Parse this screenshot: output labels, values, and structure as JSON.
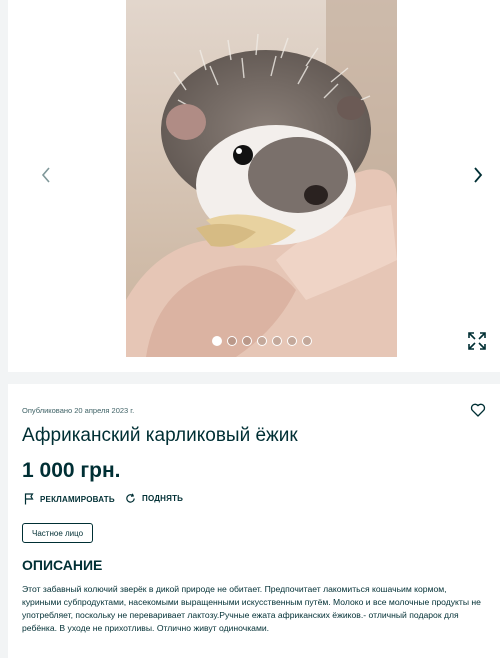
{
  "gallery": {
    "image_alt": "African pygmy hedgehog in hand",
    "image_count": 7,
    "active_index": 0,
    "icons": {
      "prev": "chevron-left-icon",
      "next": "chevron-right-icon",
      "expand": "expand-icon"
    }
  },
  "listing": {
    "published": "Опубликовано 20 апреля 2023 г.",
    "title": "Африканский карликовый ёжик",
    "price": "1 000 грн.",
    "actions": {
      "promote_label": "РЕКЛАМИРОВАТЬ",
      "raise_label": "ПОДНЯТЬ"
    },
    "seller_type": "Частное лицо",
    "description_heading": "ОПИСАНИЕ",
    "description": "Этот забавный колючий зверёк в дикой природе не обитает. Предпочитает лакомиться кошачьим кормом, куриными субпродуктами, насекомыми выращенными искусственным путём. Молоко и все молочные продукты не употребляет, поскольку не переваривает лактозу.Ручные ежата африканских ёжиков.- отличный подарок для ребёнка. В уходе не прихотливы. Отлично живут одиночками."
  },
  "colors": {
    "text": "#002f34",
    "muted": "#406367",
    "background": "#f2f4f5",
    "card": "#ffffff"
  }
}
